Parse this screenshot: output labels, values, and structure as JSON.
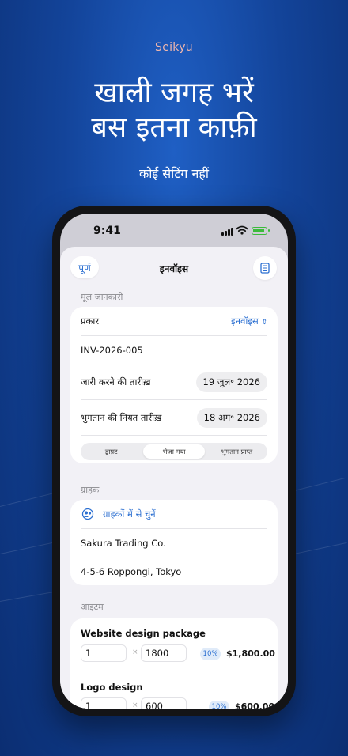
{
  "promo": {
    "brand": "Seikyu",
    "headline_line1": "खाली जगह भरें",
    "headline_line2": "बस इतना काफ़ी",
    "subtitle": "कोई सेटिंग नहीं"
  },
  "statusbar": {
    "time": "9:41"
  },
  "nav": {
    "done_label": "पूर्ण",
    "title": "इनवॉइस",
    "preview_icon": "invoice-preview-icon"
  },
  "basic_info": {
    "section_label": "मूल जानकारी",
    "type_label": "प्रकार",
    "type_value": "इनवॉइस",
    "invoice_number": "INV-2026-005",
    "issue_date_label": "जारी करने की तारीख़",
    "issue_date_value": "19 जुल॰ 2026",
    "due_date_label": "भुगतान की नियत तारीख़",
    "due_date_value": "18 अग॰ 2026",
    "status_segments": [
      "ड्राफ़्ट",
      "भेजा गया",
      "भुगतान प्राप्त"
    ],
    "status_selected": "भेजा गया"
  },
  "customer": {
    "section_label": "ग्राहक",
    "choose_label": "ग्राहकों में से चुनें",
    "name": "Sakura Trading Co.",
    "address": "4-5-6 Roppongi, Tokyo"
  },
  "items": {
    "section_label": "आइटम",
    "list": [
      {
        "name": "Website design package",
        "qty": "1",
        "times": "×",
        "price": "1800",
        "tax": "10%",
        "amount": "$1,800.00"
      },
      {
        "name": "Logo design",
        "qty": "1",
        "times": "×",
        "price": "600",
        "tax": "10%",
        "amount": "$600.00"
      }
    ]
  },
  "colors": {
    "accent": "#2b6fd1",
    "background": "#13449a",
    "brand": "#f0b7ad"
  }
}
